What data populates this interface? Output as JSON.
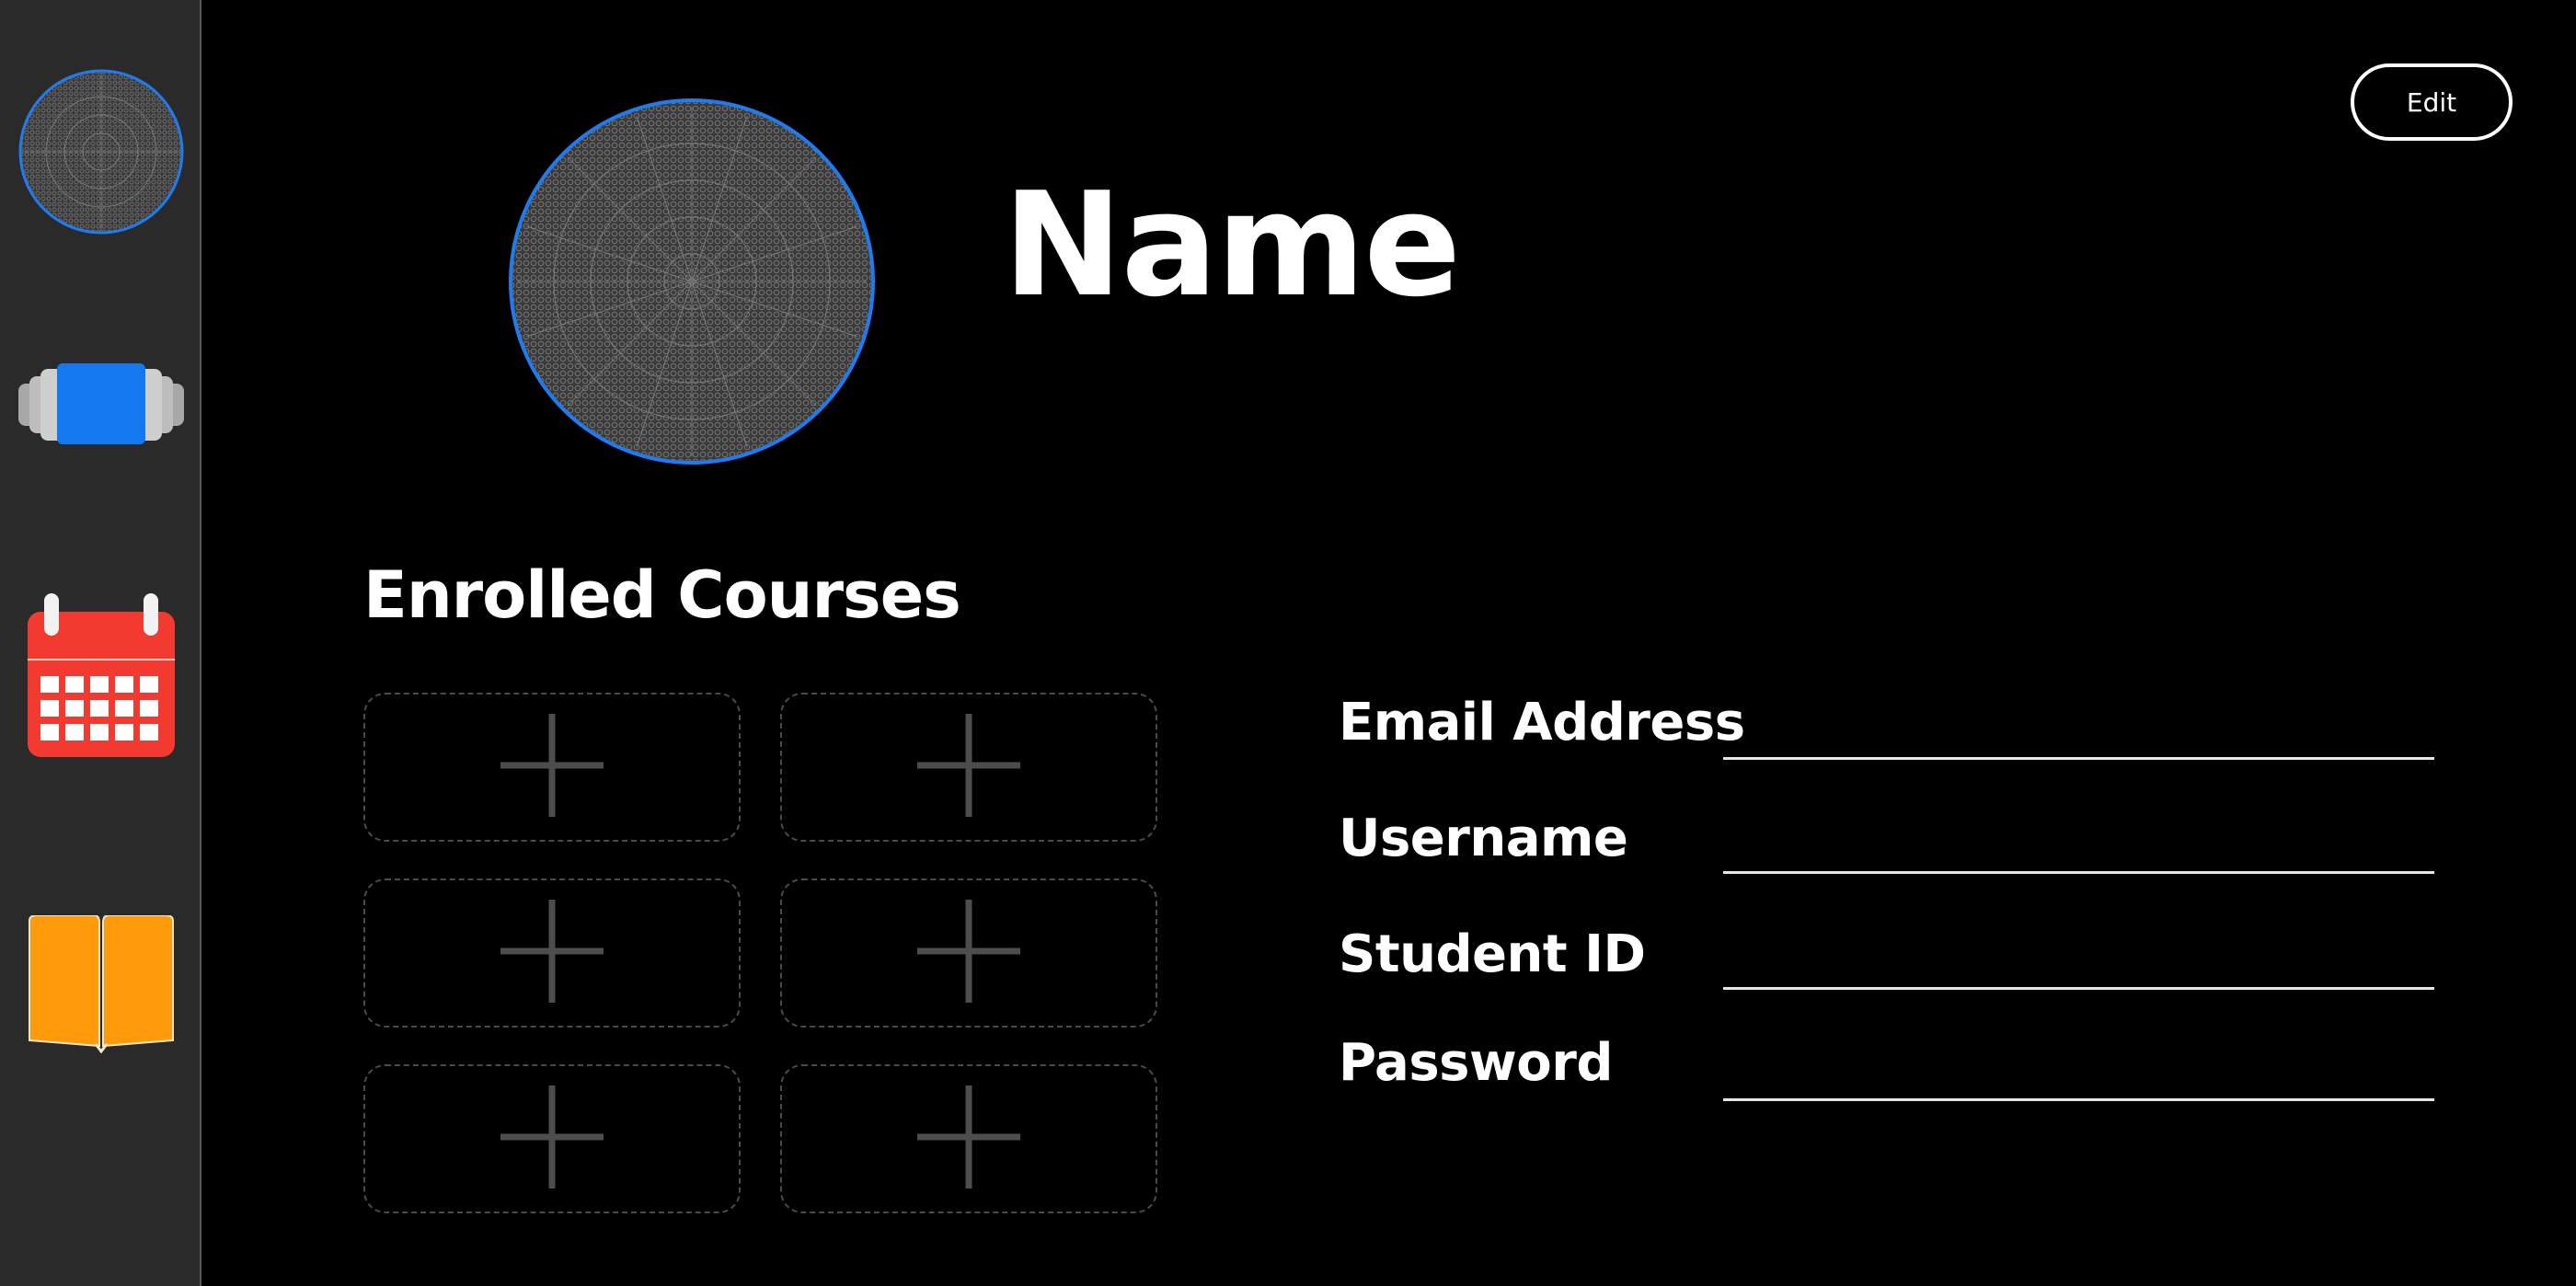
{
  "header": {
    "edit_label": "Edit"
  },
  "profile": {
    "name": "Name",
    "avatar_icon": "patterned-avatar-icon",
    "avatar_border_color": "#1e7bf0"
  },
  "sidebar": {
    "items": [
      {
        "id": "profile",
        "icon": "avatar-icon"
      },
      {
        "id": "courses",
        "icon": "cards-icon",
        "color": "#1478f0"
      },
      {
        "id": "calendar",
        "icon": "calendar-icon",
        "color": "#f23a30"
      },
      {
        "id": "books",
        "icon": "book-icon",
        "color": "#ff9a0a"
      }
    ]
  },
  "courses": {
    "title": "Enrolled Courses",
    "slot_icon": "plus-icon",
    "slot_count": 6
  },
  "form": {
    "fields": [
      {
        "label": "Email Address",
        "value": ""
      },
      {
        "label": "Username",
        "value": ""
      },
      {
        "label": "Student ID",
        "value": ""
      },
      {
        "label": "Password",
        "value": ""
      }
    ]
  }
}
